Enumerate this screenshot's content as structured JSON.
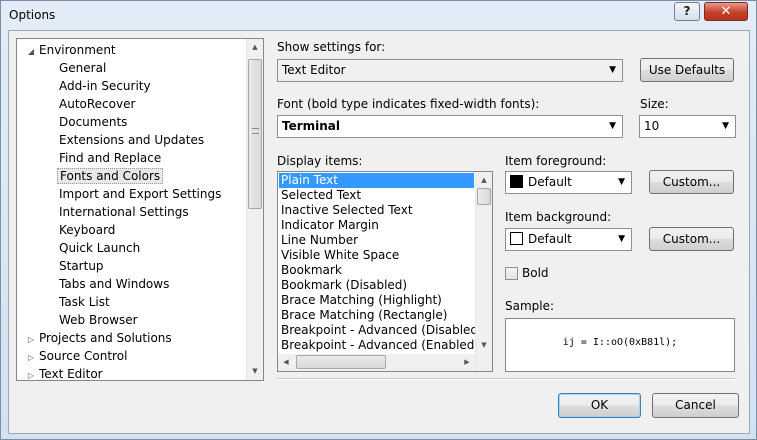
{
  "window": {
    "title": "Options",
    "help_label": "?",
    "close_label": "✕"
  },
  "tree": {
    "items": [
      {
        "label": "Environment",
        "arrow": "◢",
        "level": 0
      },
      {
        "label": "General",
        "level": 1
      },
      {
        "label": "Add-in Security",
        "level": 1
      },
      {
        "label": "AutoRecover",
        "level": 1
      },
      {
        "label": "Documents",
        "level": 1
      },
      {
        "label": "Extensions and Updates",
        "level": 1
      },
      {
        "label": "Find and Replace",
        "level": 1
      },
      {
        "label": "Fonts and Colors",
        "level": 1,
        "selected": true
      },
      {
        "label": "Import and Export Settings",
        "level": 1
      },
      {
        "label": "International Settings",
        "level": 1
      },
      {
        "label": "Keyboard",
        "level": 1
      },
      {
        "label": "Quick Launch",
        "level": 1
      },
      {
        "label": "Startup",
        "level": 1
      },
      {
        "label": "Tabs and Windows",
        "level": 1
      },
      {
        "label": "Task List",
        "level": 1
      },
      {
        "label": "Web Browser",
        "level": 1
      },
      {
        "label": "Projects and Solutions",
        "arrow": "▷",
        "level": 0
      },
      {
        "label": "Source Control",
        "arrow": "▷",
        "level": 0
      },
      {
        "label": "Text Editor",
        "arrow": "▷",
        "level": 0
      }
    ]
  },
  "settings": {
    "show_settings_label": "Show settings for:",
    "show_settings_value": "Text Editor",
    "use_defaults_label": "Use Defaults",
    "font_label": "Font (bold type indicates fixed-width fonts):",
    "font_value": "Terminal",
    "size_label": "Size:",
    "size_value": "10",
    "display_items_label": "Display items:",
    "display_items": [
      "Plain Text",
      "Selected Text",
      "Inactive Selected Text",
      "Indicator Margin",
      "Line Number",
      "Visible White Space",
      "Bookmark",
      "Bookmark (Disabled)",
      "Brace Matching (Highlight)",
      "Brace Matching (Rectangle)",
      "Breakpoint - Advanced (Disabled)",
      "Breakpoint - Advanced (Enabled)"
    ],
    "selected_item": 0,
    "foreground_label": "Item foreground:",
    "foreground_value": "Default",
    "foreground_color": "#000000",
    "background_label": "Item background:",
    "background_value": "Default",
    "background_color": "#ffffff",
    "custom_label": "Custom...",
    "bold_label": "Bold",
    "bold_checked": false,
    "sample_label": "Sample:",
    "sample_text": "ij = I::oO(0xB81l);"
  },
  "footer": {
    "ok_label": "OK",
    "cancel_label": "Cancel"
  },
  "colors": {
    "selection": "#3399ff",
    "close_button": "#c4412b"
  }
}
